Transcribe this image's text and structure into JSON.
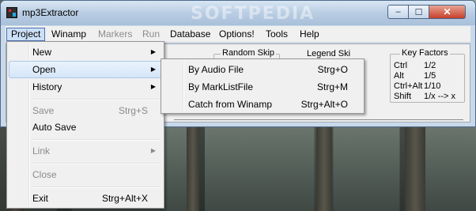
{
  "window": {
    "title": "mp3Extractor",
    "watermark": "SOFTPEDIA",
    "buttons": {
      "minimize": "–",
      "maximize": "☐",
      "close": "✕"
    }
  },
  "menubar": {
    "items": [
      {
        "label": "Project",
        "state": "active"
      },
      {
        "label": "Winamp",
        "state": "enabled"
      },
      {
        "label": "Markers",
        "state": "disabled"
      },
      {
        "label": "Run",
        "state": "disabled"
      },
      {
        "label": "Database",
        "state": "enabled"
      },
      {
        "label": "Options!",
        "state": "enabled"
      },
      {
        "label": "Tools",
        "state": "enabled"
      },
      {
        "label": "Help",
        "state": "enabled"
      }
    ]
  },
  "panel": {
    "random_skip_label": "Random Skip",
    "partial_label": "Legend Ski",
    "key_factors": {
      "title": "Key Factors",
      "rows": [
        {
          "key": "Ctrl",
          "value": "1/2"
        },
        {
          "key": "Alt",
          "value": "1/5"
        },
        {
          "key": "Ctrl+Alt",
          "value": "1/10"
        },
        {
          "key": "Shift",
          "value": "1/x --> x"
        }
      ]
    }
  },
  "project_menu": {
    "items": [
      {
        "label": "New",
        "shortcut": "",
        "submenu": true,
        "state": "enabled"
      },
      {
        "label": "Open",
        "shortcut": "",
        "submenu": true,
        "state": "hover"
      },
      {
        "label": "History",
        "shortcut": "",
        "submenu": true,
        "state": "enabled"
      },
      {
        "label": "Save",
        "shortcut": "Strg+S",
        "submenu": false,
        "state": "disabled"
      },
      {
        "label": "Auto Save",
        "shortcut": "",
        "submenu": false,
        "state": "enabled"
      },
      {
        "label": "Link",
        "shortcut": "",
        "submenu": true,
        "state": "disabled"
      },
      {
        "label": "Close",
        "shortcut": "",
        "submenu": false,
        "state": "disabled"
      },
      {
        "label": "Exit",
        "shortcut": "Strg+Alt+X",
        "submenu": false,
        "state": "enabled"
      }
    ]
  },
  "open_submenu": {
    "items": [
      {
        "label": "By Audio File",
        "shortcut": "Strg+O"
      },
      {
        "label": "By MarkListFile",
        "shortcut": "Strg+M"
      },
      {
        "label": "Catch from Winamp",
        "shortcut": "Strg+Alt+O"
      }
    ]
  },
  "icons": {
    "submenu_arrow": "▶"
  }
}
